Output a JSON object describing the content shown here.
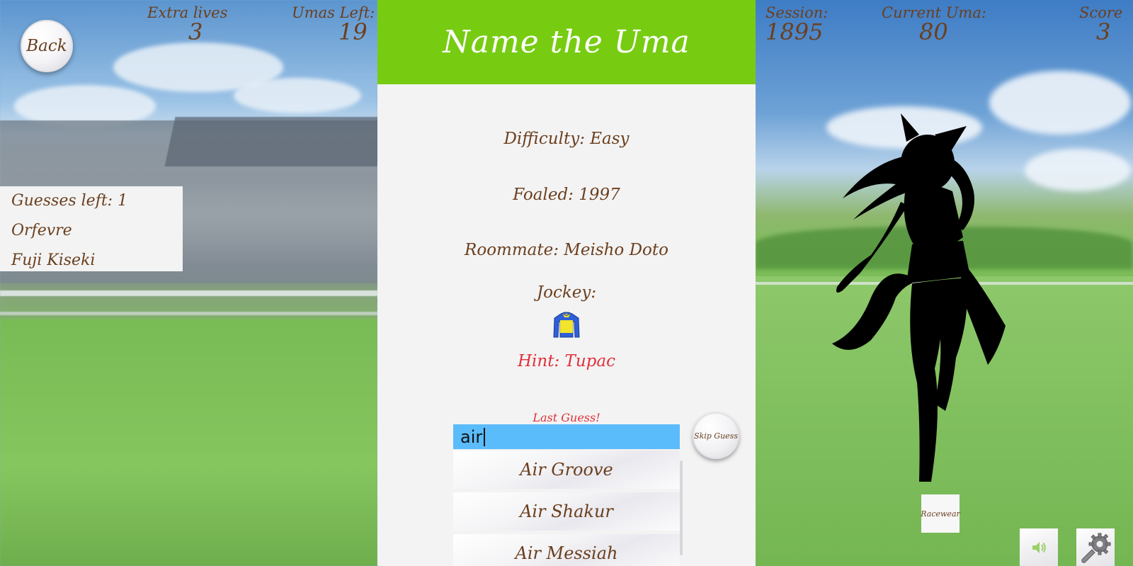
{
  "header": {
    "title": "Name the Uma",
    "back_label": "Back"
  },
  "stats": {
    "extra_lives_label": "Extra lives",
    "extra_lives_value": "3",
    "umas_left_label": "Umas Left:",
    "umas_left_value": "19",
    "session_label": "Session:",
    "session_value": "1895",
    "current_uma_label": "Current Uma:",
    "current_uma_value": "80",
    "score_label": "Score",
    "score_value": "3"
  },
  "guesses": {
    "left_label": "Guesses left: 1",
    "items": [
      "Orfevre",
      "Fuji Kiseki"
    ]
  },
  "clues": {
    "difficulty": "Difficulty: Easy",
    "foaled": "Foaled: 1997",
    "roommate": "Roommate: Meisho Doto",
    "jockey_label": "Jockey:",
    "hint": "Hint: Tupac",
    "last_guess": "Last Guess!"
  },
  "search": {
    "value": "air",
    "options": [
      "Air Groove",
      "Air Shakur",
      "Air Messiah"
    ]
  },
  "buttons": {
    "skip_guess": "Skip Guess",
    "racewear": "Racewear"
  },
  "icons": {
    "sound": "speaker-icon",
    "settings": "wrench-gear-icon",
    "jockey": "jockey-silks-icon"
  },
  "colors": {
    "title_bar": "#77cc12",
    "text_brown": "#6b3f1e",
    "hint_red": "#e0303a",
    "search_blue": "#5bbcfb",
    "jersey_yellow": "#f2e32b",
    "jersey_blue": "#2f5fd6"
  }
}
